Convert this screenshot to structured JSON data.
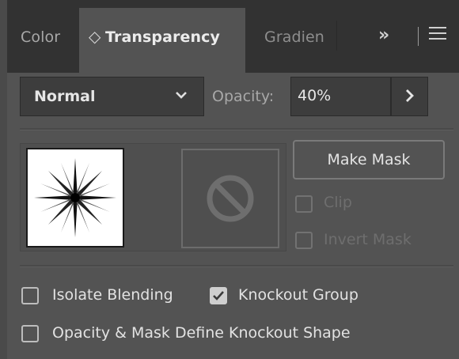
{
  "tabs": {
    "color": "Color",
    "transparency_arrows": "◇",
    "transparency": "Transparency",
    "gradient": "Gradien",
    "more": "»",
    "separator": "|"
  },
  "blend": {
    "mode": "Normal",
    "opacity_label": "Opacity:",
    "opacity_value": "40%"
  },
  "mask": {
    "make_mask": "Make Mask",
    "clip": "Clip",
    "invert_mask": "Invert Mask",
    "clip_checked": false,
    "invert_checked": false
  },
  "options": {
    "isolate_blending": "Isolate Blending",
    "isolate_checked": false,
    "knockout_group": "Knockout Group",
    "knockout_checked": true,
    "opacity_mask_knockout": "Opacity & Mask Define Knockout Shape",
    "opacity_mask_knockout_checked": false
  },
  "colors": {
    "panel_bg": "#535353",
    "tabbar_bg": "#323232",
    "field_bg": "#3d3d3d"
  }
}
